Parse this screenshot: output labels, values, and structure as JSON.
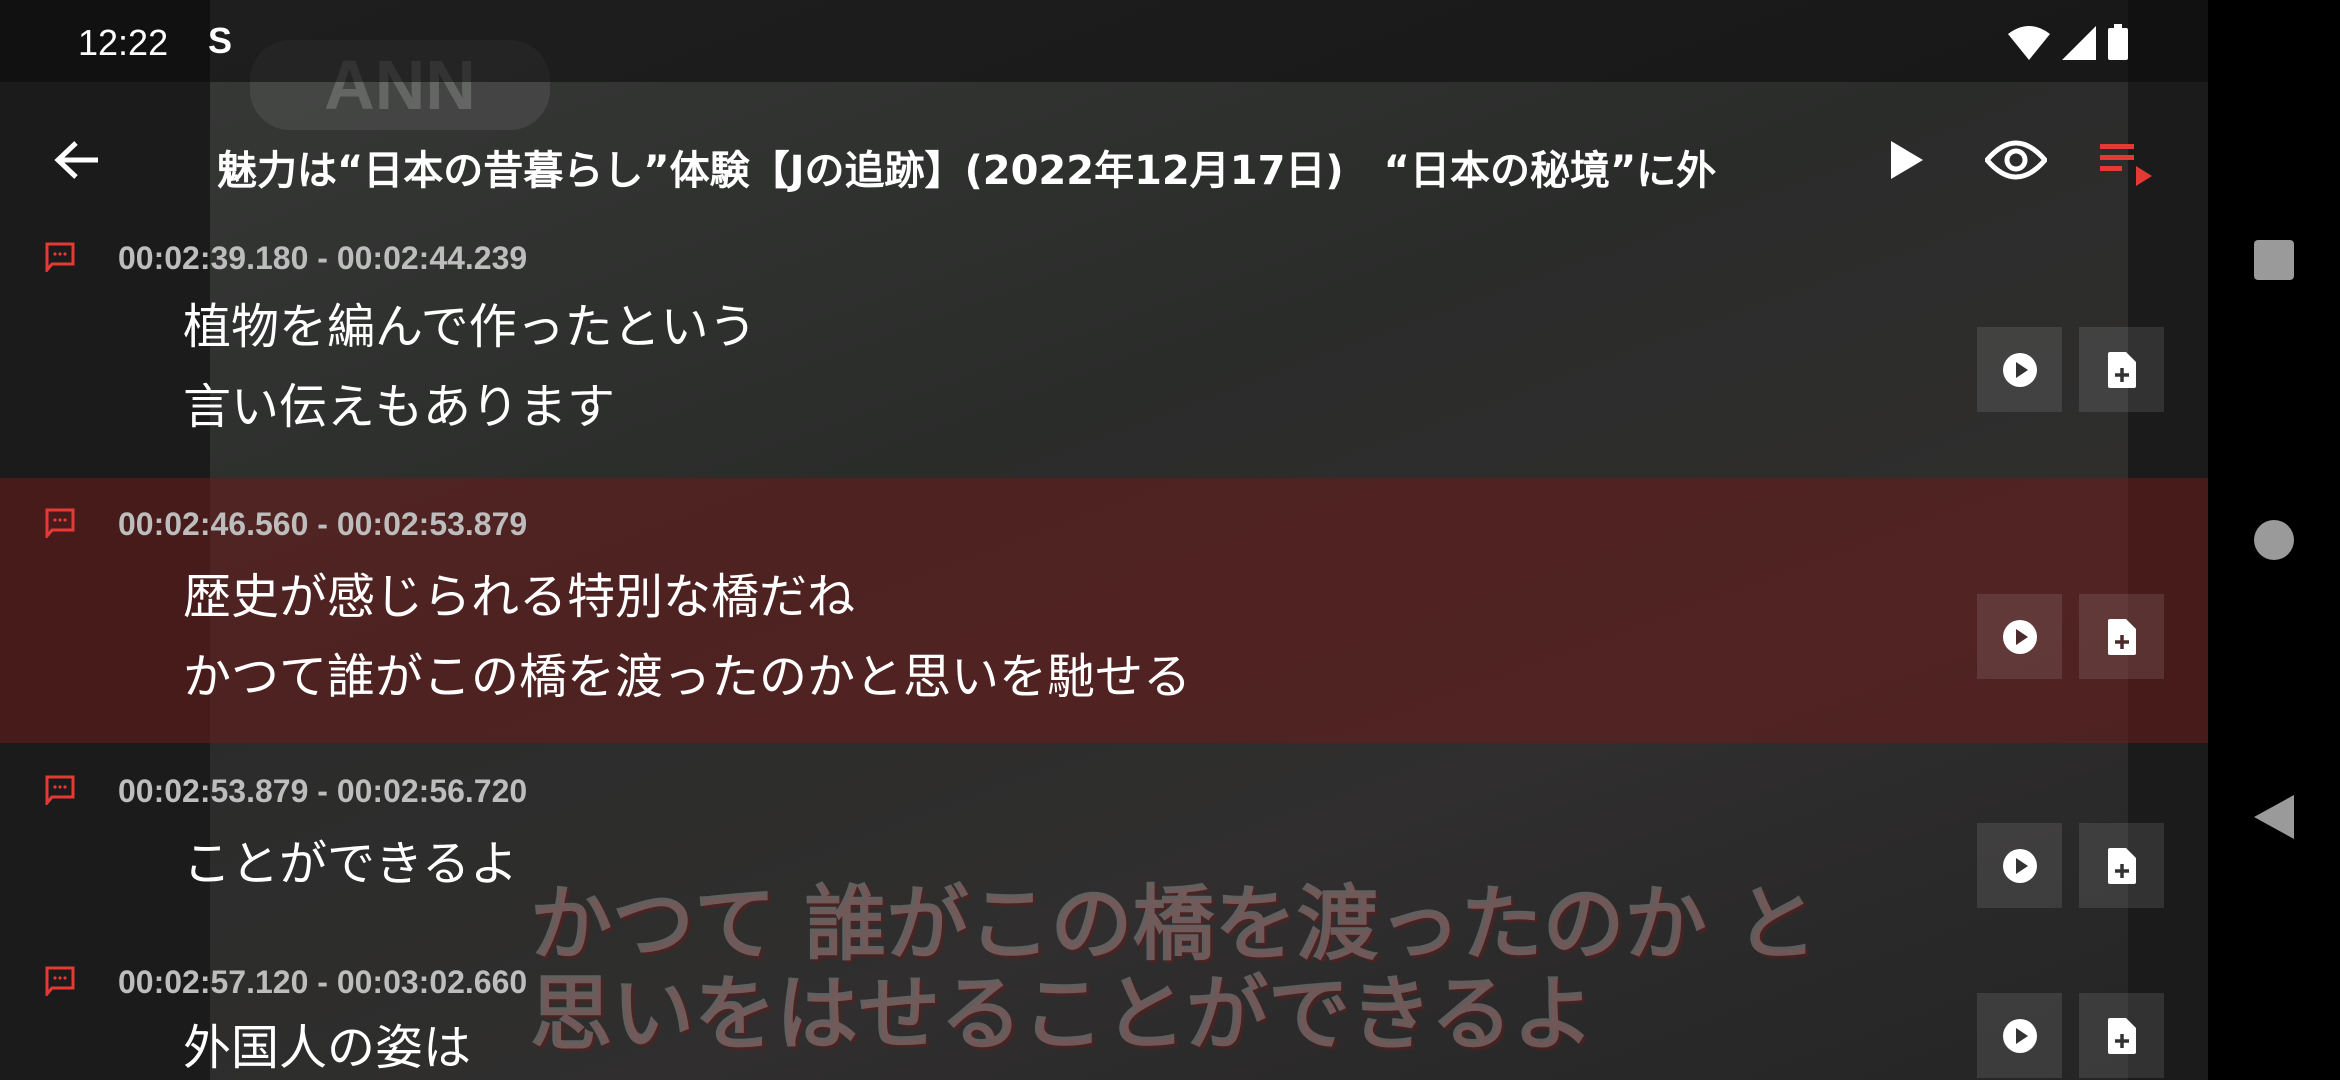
{
  "status_bar": {
    "time": "12:22",
    "notification_icon": "S"
  },
  "header": {
    "title": "魅力は“日本の昔暮らし”体験【Jの追跡】(2022年12月17日)　“日本の秘境”に外",
    "back_icon": "arrow-left-icon",
    "play_icon": "play-icon",
    "eye_icon": "eye-icon",
    "queue_icon": "playlist-play-icon"
  },
  "video": {
    "logo": "ANN",
    "burned_caption": [
      "かつて 誰がこの橋を渡ったのか と",
      "思いをはせることができるよ"
    ]
  },
  "subtitles": [
    {
      "time": "00:02:39.180 - 00:02:44.239",
      "lines": [
        "植物を編んで作ったという",
        "言い伝えもあります"
      ],
      "active": false
    },
    {
      "time": "00:02:46.560 - 00:02:53.879",
      "lines": [
        "歴史が感じられる特別な橋だね",
        "かつて誰がこの橋を渡ったのかと思いを馳せる"
      ],
      "active": true
    },
    {
      "time": "00:02:53.879 - 00:02:56.720",
      "lines": [
        "ことができるよ"
      ],
      "active": false
    },
    {
      "time": "00:02:57.120 - 00:03:02.660",
      "lines": [
        "外国人の姿は"
      ],
      "active": false
    }
  ],
  "colors": {
    "accent": "#e53935",
    "highlight": "#6e1c1c"
  }
}
